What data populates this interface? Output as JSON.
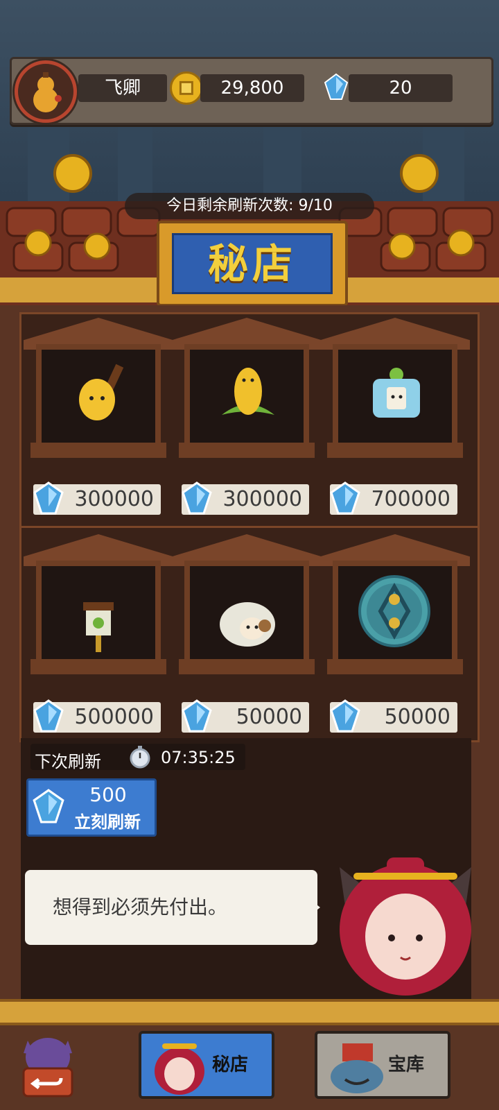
{
  "player": {
    "name": "飞卿",
    "coins": "29,800",
    "gems": "20"
  },
  "shop": {
    "title": "秘店",
    "refresh_count_label": "今日剩余刷新次数: 9/10",
    "next_refresh_label": "下次刷新",
    "next_refresh_timer": "07:35:25",
    "refresh_cost": "500",
    "refresh_button_label": "立刻刷新",
    "items": [
      {
        "name": "corn-on-stick",
        "price": "300000"
      },
      {
        "name": "wheat-sprout",
        "price": "300000"
      },
      {
        "name": "tv-box-creature",
        "price": "700000"
      },
      {
        "name": "scarecrow-sign",
        "price": "500000"
      },
      {
        "name": "sheep",
        "price": "50000"
      },
      {
        "name": "rune-orb",
        "price": "50000"
      }
    ]
  },
  "dialog": {
    "text": "想得到必须先付出。"
  },
  "bottom_nav": {
    "back_icon": "back-arrow-icon",
    "tab_shop": "秘店",
    "tab_vault": "宝库"
  },
  "colors": {
    "gem": "#4aa3e0",
    "coin": "#e7b21f",
    "button_blue": "#3d7cd0"
  }
}
